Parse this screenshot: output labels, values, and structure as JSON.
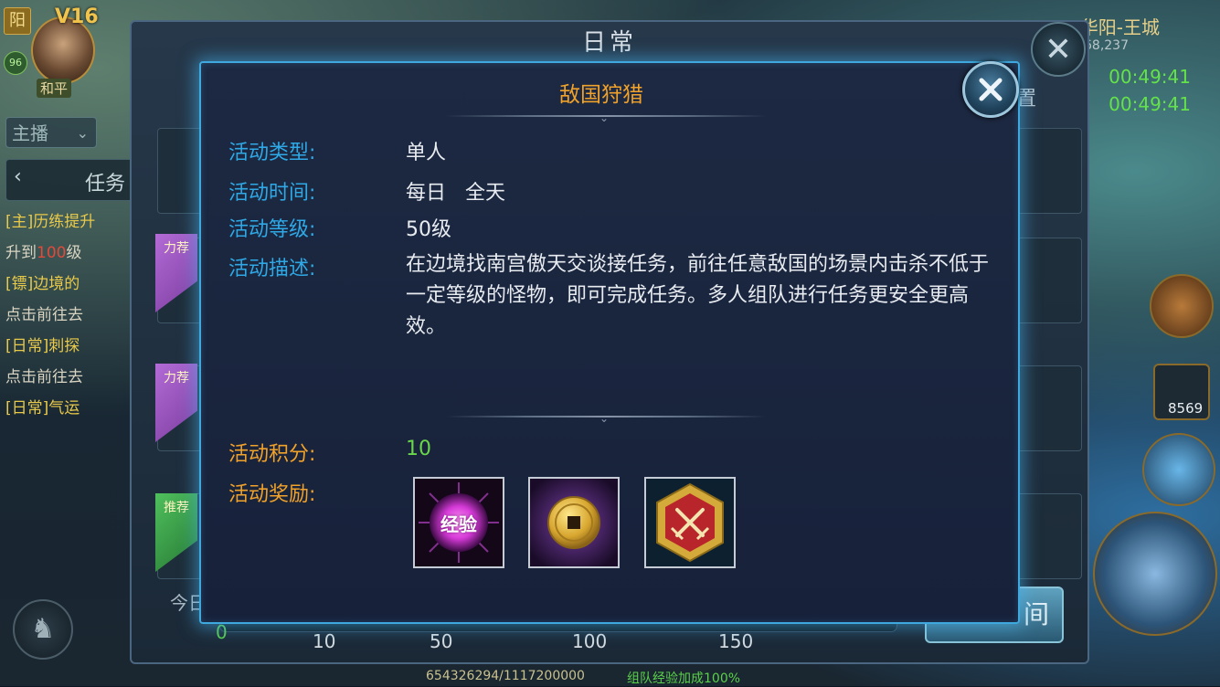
{
  "game_hud": {
    "realm_tag": "阳",
    "vip_label": "V16",
    "player_level": "96",
    "pk_mode": "和平",
    "server_name": "华阳-王城",
    "coords": "368,237",
    "timer_1": "00:49:41",
    "timer_2": "00:49:41",
    "item_count": "8569"
  },
  "chat": {
    "channel": "主播",
    "task_tab_label": "任务"
  },
  "tasks": [
    {
      "title": "[主]历练提升",
      "sub_prefix": "升到",
      "sub_level": "100",
      "sub_suffix": "级"
    },
    {
      "title": "[镖]边境的",
      "sub": "点击前往去"
    },
    {
      "title": "[日常]刺探",
      "sub": "点击前往去"
    },
    {
      "title": "[日常]气运"
    }
  ],
  "daily_panel": {
    "title": "日常",
    "settings_label": "置",
    "ribbons": [
      "力荐",
      "力荐",
      "推荐"
    ],
    "today_label": "今日",
    "progress_start": "0",
    "progress_ticks": [
      "10",
      "50",
      "100",
      "150"
    ],
    "goto_label": "间",
    "exp_text": "654326294/1117200000",
    "exp_bonus": "组队经验加成100%"
  },
  "modal": {
    "title": "敌国狩猎",
    "fields": [
      {
        "label": "活动类型:",
        "value": "单人"
      },
      {
        "label": "活动时间:",
        "value": "每日   全天"
      },
      {
        "label": "活动等级:",
        "value": "50级"
      },
      {
        "label": "活动描述:",
        "value": "在边境找南宫傲天交谈接任务，前往任意敌国的场景内击杀不低于一定等级的怪物，即可完成任务。多人组队进行任务更安全更高效。"
      }
    ],
    "score_label": "活动积分:",
    "score_value": "10",
    "rewards_label": "活动奖励:",
    "rewards": [
      {
        "icon": "experience-orb-icon",
        "text": "经验",
        "color": "#e04de6"
      },
      {
        "icon": "copper-coin-icon",
        "color": "#d7a62f"
      },
      {
        "icon": "crossed-swords-badge-icon",
        "color": "#b8262b"
      }
    ]
  },
  "colors": {
    "label_blue": "#2fa8e6",
    "label_orange": "#f0a22a",
    "score_green": "#69d64b",
    "modal_border": "#3fa9df"
  }
}
